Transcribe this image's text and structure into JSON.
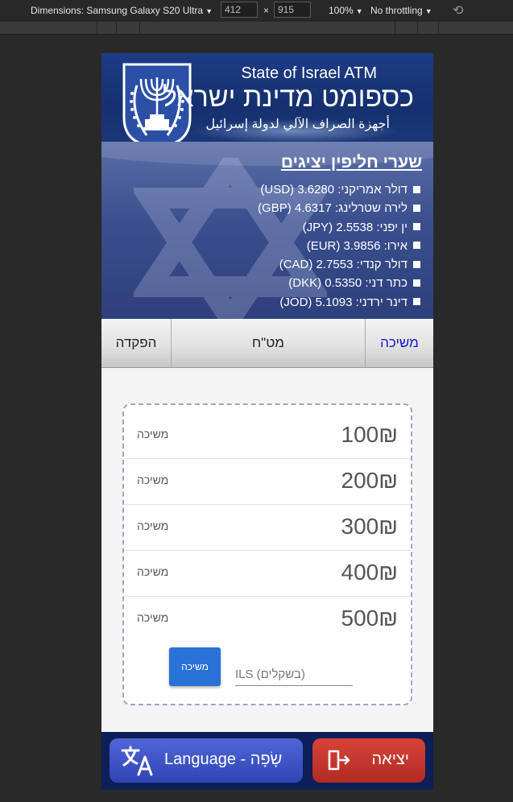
{
  "devtools": {
    "device_label": "Dimensions: Samsung Galaxy S20 Ultra",
    "width": "412",
    "times": "×",
    "height": "915",
    "zoom": "100%",
    "throttle": "No throttling"
  },
  "header": {
    "title_en": "State of Israel ATM",
    "title_he": "כספומט מדינת ישראל",
    "title_ar": "أجهزة الصراف الآلي لدولة إسرائيل"
  },
  "rates": {
    "title": "שערי חליפין יציגים",
    "items": [
      "דולר אמריקני: 3.6280 (USD)",
      "לירה שטרלינג: 4.6317 (GBP)",
      "ין יפני: 2.5538 (JPY)",
      "אירו: 3.9856 (EUR)",
      "דולר קנדי: 2.7553 (CAD)",
      "כתר דני: 0.5350 (DKK)",
      "דינר ירדני: 5.1093 (JOD)"
    ]
  },
  "tabs": {
    "deposit": "הפקדה",
    "forex": "מט\"ח",
    "withdraw": "משיכה"
  },
  "withdraw": {
    "rows": [
      {
        "amount": "100₪",
        "label": "משיכה"
      },
      {
        "amount": "200₪",
        "label": "משיכה"
      },
      {
        "amount": "300₪",
        "label": "משיכה"
      },
      {
        "amount": "400₪",
        "label": "משיכה"
      },
      {
        "amount": "500₪",
        "label": "משיכה"
      }
    ],
    "button_label": "משיכה",
    "input_placeholder": "ILS (בשקלים)"
  },
  "bottom": {
    "language_label": "Language - שָׂפָה",
    "exit_label": "יציאה"
  },
  "icons": {
    "translate": "translate-icon",
    "exit": "exit-door-icon",
    "emblem": "israel-emblem-icon"
  },
  "colors": {
    "header_blue": "#1d3c86",
    "active_tab": "#1515d4",
    "withdraw_button": "#2a72d8",
    "language_button": "#3f56c8",
    "exit_button": "#c8352c"
  }
}
